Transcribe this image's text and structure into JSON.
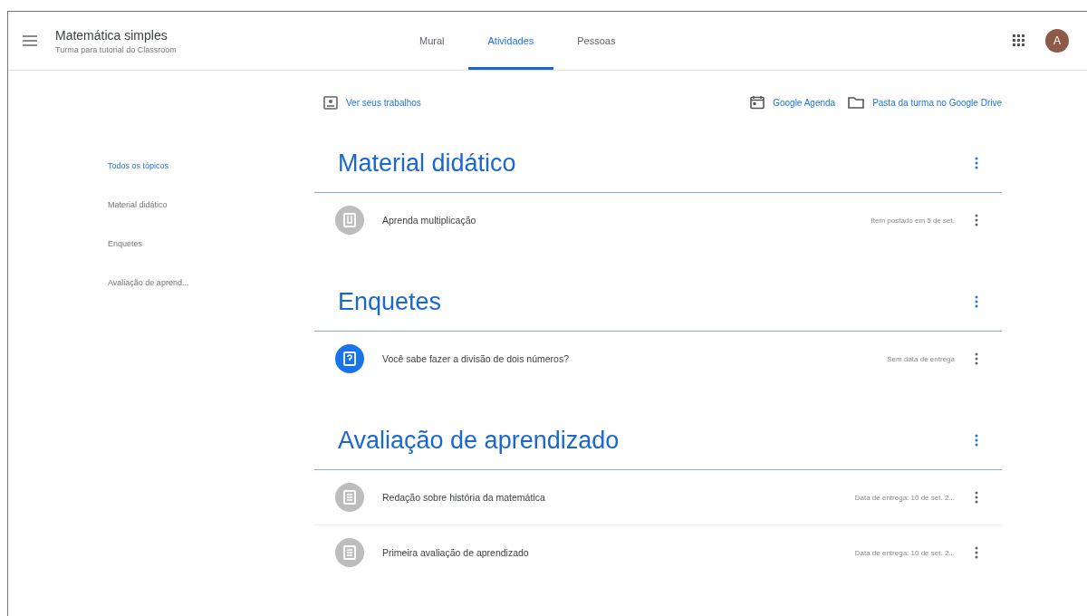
{
  "header": {
    "title": "Matemática simples",
    "subtitle": "Turma para tutorial do Classroom",
    "avatar": "A"
  },
  "tabs": [
    {
      "label": "Mural",
      "selected": false
    },
    {
      "label": "Atividades",
      "selected": true
    },
    {
      "label": "Pessoas",
      "selected": false
    }
  ],
  "links": {
    "work": "Ver seus trabalhos",
    "calendar": "Google Agenda",
    "drive": "Pasta da turma no Google Drive"
  },
  "sidebar": {
    "items": [
      {
        "label": "Todos os tópicos",
        "selected": true
      },
      {
        "label": "Material didático",
        "selected": false
      },
      {
        "label": "Enquetes",
        "selected": false
      },
      {
        "label": "Avaliação de aprend...",
        "selected": false
      }
    ]
  },
  "topics": [
    {
      "title": "Material didático",
      "items": [
        {
          "kind": "material",
          "title": "Aprenda multiplicação",
          "meta": "Item postado em 5 de set."
        }
      ]
    },
    {
      "title": "Enquetes",
      "items": [
        {
          "kind": "question",
          "title": "Você sabe fazer a divisão de dois números?",
          "meta": "Sem data de entrega"
        }
      ]
    },
    {
      "title": "Avaliação de aprendizado",
      "items": [
        {
          "kind": "assignment",
          "title": "Redação sobre história da matemática",
          "meta": "Data de entrega: 10 de set. 2..."
        },
        {
          "kind": "assignment",
          "title": "Primeira avaliação de aprendizado",
          "meta": "Data de entrega: 10 de set. 2..."
        }
      ]
    }
  ]
}
